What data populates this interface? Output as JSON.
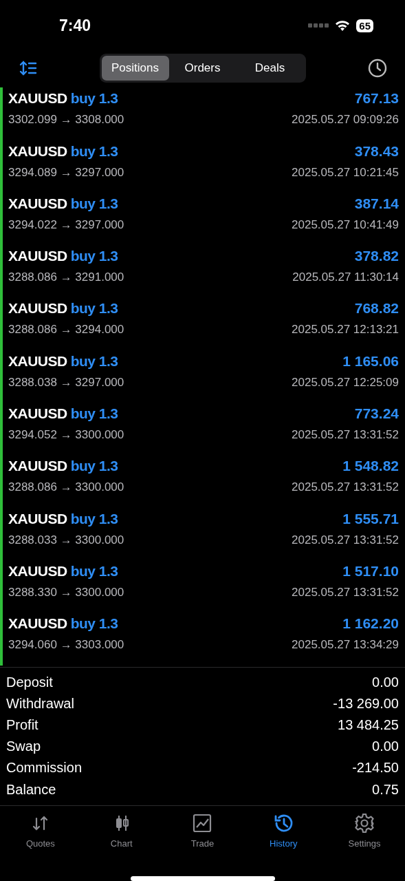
{
  "status_bar": {
    "time": "7:40",
    "battery": "65"
  },
  "toolbar": {
    "tabs": [
      {
        "label": "Positions",
        "selected": true
      },
      {
        "label": "Orders",
        "selected": false
      },
      {
        "label": "Deals",
        "selected": false
      }
    ]
  },
  "deals": [
    {
      "kind": "buy",
      "symbol": "XAUUSD",
      "direction": "buy 1.3",
      "prices": "3302.099 → 3308.000",
      "profit": "767.13",
      "time": "2025.05.27 09:09:26"
    },
    {
      "kind": "buy",
      "symbol": "XAUUSD",
      "direction": "buy 1.3",
      "prices": "3294.089 → 3297.000",
      "profit": "378.43",
      "time": "2025.05.27 10:21:45"
    },
    {
      "kind": "buy",
      "symbol": "XAUUSD",
      "direction": "buy 1.3",
      "prices": "3294.022 → 3297.000",
      "profit": "387.14",
      "time": "2025.05.27 10:41:49"
    },
    {
      "kind": "buy",
      "symbol": "XAUUSD",
      "direction": "buy 1.3",
      "prices": "3288.086 → 3291.000",
      "profit": "378.82",
      "time": "2025.05.27 11:30:14"
    },
    {
      "kind": "buy",
      "symbol": "XAUUSD",
      "direction": "buy 1.3",
      "prices": "3288.086 → 3294.000",
      "profit": "768.82",
      "time": "2025.05.27 12:13:21"
    },
    {
      "kind": "buy",
      "symbol": "XAUUSD",
      "direction": "buy 1.3",
      "prices": "3288.038 → 3297.000",
      "profit": "1 165.06",
      "time": "2025.05.27 12:25:09"
    },
    {
      "kind": "buy",
      "symbol": "XAUUSD",
      "direction": "buy 1.3",
      "prices": "3294.052 → 3300.000",
      "profit": "773.24",
      "time": "2025.05.27 13:31:52"
    },
    {
      "kind": "buy",
      "symbol": "XAUUSD",
      "direction": "buy 1.3",
      "prices": "3288.086 → 3300.000",
      "profit": "1 548.82",
      "time": "2025.05.27 13:31:52"
    },
    {
      "kind": "buy",
      "symbol": "XAUUSD",
      "direction": "buy 1.3",
      "prices": "3288.033 → 3300.000",
      "profit": "1 555.71",
      "time": "2025.05.27 13:31:52"
    },
    {
      "kind": "buy",
      "symbol": "XAUUSD",
      "direction": "buy 1.3",
      "prices": "3288.330 → 3300.000",
      "profit": "1 517.10",
      "time": "2025.05.27 13:31:52"
    },
    {
      "kind": "buy",
      "symbol": "XAUUSD",
      "direction": "buy 1.3",
      "prices": "3294.060 → 3303.000",
      "profit": "1 162.20",
      "time": "2025.05.27 13:34:29"
    }
  ],
  "summary": [
    {
      "label": "Deposit",
      "value": "0.00"
    },
    {
      "label": "Withdrawal",
      "value": "-13 269.00"
    },
    {
      "label": "Profit",
      "value": "13 484.25"
    },
    {
      "label": "Swap",
      "value": "0.00"
    },
    {
      "label": "Commission",
      "value": "-214.50"
    },
    {
      "label": "Balance",
      "value": "0.75"
    }
  ],
  "tab_bar": [
    {
      "kind": "quotes",
      "label": "Quotes",
      "selected": false
    },
    {
      "kind": "chart",
      "label": "Chart",
      "selected": false
    },
    {
      "kind": "trade",
      "label": "Trade",
      "selected": false
    },
    {
      "kind": "history",
      "label": "History",
      "selected": true
    },
    {
      "kind": "settings",
      "label": "Settings",
      "selected": false
    }
  ]
}
